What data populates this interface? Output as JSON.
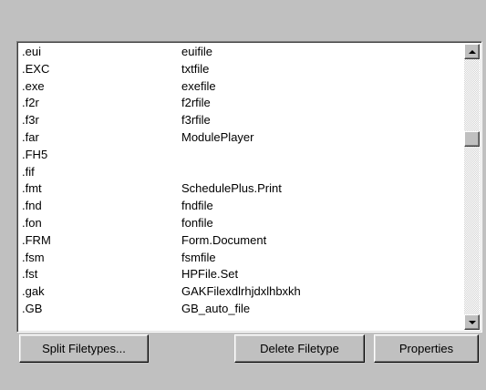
{
  "filetypes": {
    "rows": [
      {
        "ext": ".eui",
        "type": "euifile"
      },
      {
        "ext": ".EXC",
        "type": "txtfile"
      },
      {
        "ext": ".exe",
        "type": "exefile"
      },
      {
        "ext": ".f2r",
        "type": "f2rfile"
      },
      {
        "ext": ".f3r",
        "type": "f3rfile"
      },
      {
        "ext": ".far",
        "type": "ModulePlayer"
      },
      {
        "ext": ".FH5",
        "type": ""
      },
      {
        "ext": ".fif",
        "type": ""
      },
      {
        "ext": ".fmt",
        "type": "SchedulePlus.Print"
      },
      {
        "ext": ".fnd",
        "type": "fndfile"
      },
      {
        "ext": ".fon",
        "type": "fonfile"
      },
      {
        "ext": ".FRM",
        "type": "Form.Document"
      },
      {
        "ext": ".fsm",
        "type": "fsmfile"
      },
      {
        "ext": ".fst",
        "type": "HPFile.Set"
      },
      {
        "ext": ".gak",
        "type": "GAKFilexdlrhjdxlhbxkh"
      },
      {
        "ext": ".GB",
        "type": "GB_auto_file"
      }
    ],
    "scroll_position": 0.3
  },
  "buttons": {
    "split": "Split Filetypes...",
    "delete": "Delete Filetype",
    "properties": "Properties"
  }
}
